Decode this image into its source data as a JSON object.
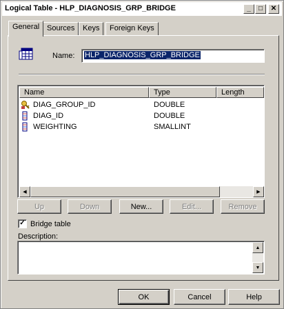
{
  "window": {
    "title": "Logical Table - HLP_DIAGNOSIS_GRP_BRIDGE"
  },
  "titlebar_buttons": {
    "minimize": "_",
    "maximize": "□",
    "close": "✕"
  },
  "tabs": [
    {
      "label": "General"
    },
    {
      "label": "Sources"
    },
    {
      "label": "Keys"
    },
    {
      "label": "Foreign Keys"
    }
  ],
  "general": {
    "name_label": "Name:",
    "name_value": "HLP_DIAGNOSIS_GRP_BRIDGE",
    "columns_header": {
      "name": "Name",
      "type": "Type",
      "length": "Length"
    },
    "columns": [
      {
        "name": "DIAG_GROUP_ID",
        "type": "DOUBLE",
        "icon": "key-column-icon"
      },
      {
        "name": "DIAG_ID",
        "type": "DOUBLE",
        "icon": "column-icon"
      },
      {
        "name": "WEIGHTING",
        "type": "SMALLINT",
        "icon": "column-icon"
      }
    ],
    "list_buttons": {
      "up": "Up",
      "down": "Down",
      "new": "New...",
      "edit": "Edit...",
      "remove": "Remove"
    },
    "bridge_table_label": "Bridge table",
    "bridge_table_checked": true,
    "description_label": "Description:",
    "description_value": ""
  },
  "footer_buttons": {
    "ok": "OK",
    "cancel": "Cancel",
    "help": "Help"
  },
  "colors": {
    "selection": "#0a246a",
    "face": "#d4d0c8"
  }
}
